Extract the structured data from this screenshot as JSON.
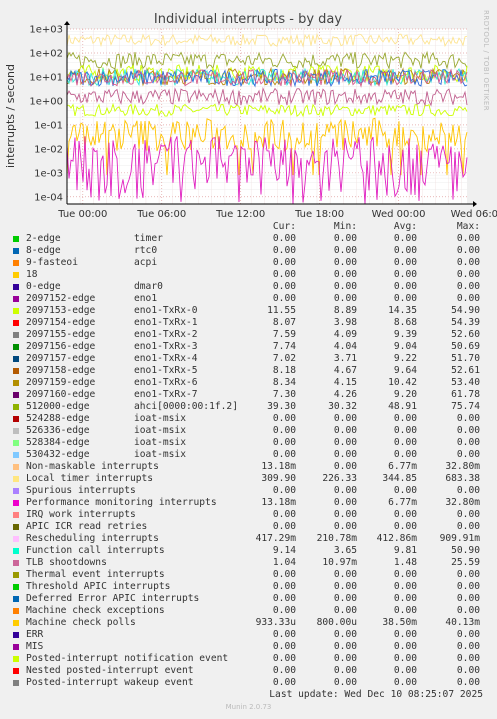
{
  "chart_data": {
    "type": "line",
    "title": "Individual interrupts - by day",
    "ylabel": "interrupts / second",
    "y_scale": "log",
    "ylim": [
      5e-05,
      1000
    ],
    "y_ticks": [
      "1e+03",
      "1e+02",
      "1e+01",
      "1e+00",
      "1e-01",
      "1e-02",
      "1e-03",
      "1e-04"
    ],
    "x_ticks": [
      "Tue 00:00",
      "Tue 06:00",
      "Tue 12:00",
      "Tue 18:00",
      "Wed 00:00",
      "Wed 06:00"
    ],
    "grid": true,
    "side_text": "RRDTOOL / TOBI OETIKER",
    "series": [
      {
        "name": "Local timer interrupts",
        "color": "#fde491",
        "approx": 345
      },
      {
        "name": "Rescheduling interrupts",
        "color": "#ccff00",
        "approx": 0.41
      },
      {
        "name": "512000-edge ahci[0000:00:1f.2]",
        "color": "#99a832",
        "approx": 48.9
      },
      {
        "name": "2097153-edge eno1-TxRx-0",
        "color": "#ccff00",
        "approx": 14.3
      },
      {
        "name": "2097159-edge eno1-TxRx-6",
        "color": "#b8860b",
        "approx": 10.4
      },
      {
        "name": "Function call interrupts",
        "color": "#2ee8d5",
        "approx": 9.8
      },
      {
        "name": "2097157-edge eno1-TxRx-4",
        "color": "#2e6bda",
        "approx": 9.2
      },
      {
        "name": "2097160-edge eno1-TxRx-7",
        "color": "#d75b8a",
        "approx": 9.2
      },
      {
        "name": "TLB shootdowns",
        "color": "#c0608f",
        "approx": 1.48
      },
      {
        "name": "Machine check polls",
        "color": "#ffc400",
        "approx": 0.0385
      },
      {
        "name": "Non-maskable interrupts",
        "color": "#e020c0",
        "approx": 0.0068
      }
    ]
  },
  "legend": {
    "headers": {
      "cur": "Cur:",
      "min": "Min:",
      "avg": "Avg:",
      "max": "Max:"
    },
    "rows": [
      {
        "name": "2-edge",
        "sub": "timer",
        "color": "#00cc00",
        "cur": "0.00",
        "min": "0.00",
        "avg": "0.00",
        "max": "0.00"
      },
      {
        "name": "8-edge",
        "sub": "rtc0",
        "color": "#0066b3",
        "cur": "0.00",
        "min": "0.00",
        "avg": "0.00",
        "max": "0.00"
      },
      {
        "name": "9-fasteoi",
        "sub": "acpi",
        "color": "#ff8000",
        "cur": "0.00",
        "min": "0.00",
        "avg": "0.00",
        "max": "0.00"
      },
      {
        "name": "18",
        "sub": "",
        "color": "#ffcc00",
        "cur": "0.00",
        "min": "0.00",
        "avg": "0.00",
        "max": "0.00"
      },
      {
        "name": "0-edge",
        "sub": "dmar0",
        "color": "#330099",
        "cur": "0.00",
        "min": "0.00",
        "avg": "0.00",
        "max": "0.00"
      },
      {
        "name": "2097152-edge",
        "sub": "eno1",
        "color": "#990099",
        "cur": "0.00",
        "min": "0.00",
        "avg": "0.00",
        "max": "0.00"
      },
      {
        "name": "2097153-edge",
        "sub": "eno1-TxRx-0",
        "color": "#ccff00",
        "cur": "11.55",
        "min": "8.89",
        "avg": "14.35",
        "max": "54.90"
      },
      {
        "name": "2097154-edge",
        "sub": "eno1-TxRx-1",
        "color": "#ff0000",
        "cur": "8.07",
        "min": "3.98",
        "avg": "8.68",
        "max": "54.39"
      },
      {
        "name": "2097155-edge",
        "sub": "eno1-TxRx-2",
        "color": "#808080",
        "cur": "7.59",
        "min": "4.09",
        "avg": "9.39",
        "max": "52.60"
      },
      {
        "name": "2097156-edge",
        "sub": "eno1-TxRx-3",
        "color": "#008f00",
        "cur": "7.74",
        "min": "4.04",
        "avg": "9.04",
        "max": "50.69"
      },
      {
        "name": "2097157-edge",
        "sub": "eno1-TxRx-4",
        "color": "#00487d",
        "cur": "7.02",
        "min": "3.71",
        "avg": "9.22",
        "max": "51.70"
      },
      {
        "name": "2097158-edge",
        "sub": "eno1-TxRx-5",
        "color": "#b35a00",
        "cur": "8.18",
        "min": "4.67",
        "avg": "9.64",
        "max": "52.61"
      },
      {
        "name": "2097159-edge",
        "sub": "eno1-TxRx-6",
        "color": "#b38f00",
        "cur": "8.34",
        "min": "4.15",
        "avg": "10.42",
        "max": "53.40"
      },
      {
        "name": "2097160-edge",
        "sub": "eno1-TxRx-7",
        "color": "#6b006b",
        "cur": "7.30",
        "min": "4.26",
        "avg": "9.20",
        "max": "61.78"
      },
      {
        "name": "512000-edge",
        "sub": "ahci[0000:00:1f.2]",
        "color": "#8fb300",
        "cur": "39.30",
        "min": "30.32",
        "avg": "48.91",
        "max": "75.74"
      },
      {
        "name": "524288-edge",
        "sub": "ioat-msix",
        "color": "#b30000",
        "cur": "0.00",
        "min": "0.00",
        "avg": "0.00",
        "max": "0.00"
      },
      {
        "name": "526336-edge",
        "sub": "ioat-msix",
        "color": "#bebebe",
        "cur": "0.00",
        "min": "0.00",
        "avg": "0.00",
        "max": "0.00"
      },
      {
        "name": "528384-edge",
        "sub": "ioat-msix",
        "color": "#80ff80",
        "cur": "0.00",
        "min": "0.00",
        "avg": "0.00",
        "max": "0.00"
      },
      {
        "name": "530432-edge",
        "sub": "ioat-msix",
        "color": "#80c9ff",
        "cur": "0.00",
        "min": "0.00",
        "avg": "0.00",
        "max": "0.00"
      },
      {
        "name": "Non-maskable interrupts",
        "sub": "",
        "color": "#ffc080",
        "cur": "13.18m",
        "min": "0.00",
        "avg": "6.77m",
        "max": "32.80m"
      },
      {
        "name": "Local timer interrupts",
        "sub": "",
        "color": "#ffe680",
        "cur": "309.90",
        "min": "226.33",
        "avg": "344.85",
        "max": "683.38"
      },
      {
        "name": "Spurious interrupts",
        "sub": "",
        "color": "#aa80ff",
        "cur": "0.00",
        "min": "0.00",
        "avg": "0.00",
        "max": "0.00"
      },
      {
        "name": "Performance monitoring interrupts",
        "sub": "",
        "color": "#ee00cc",
        "cur": "13.18m",
        "min": "0.00",
        "avg": "6.77m",
        "max": "32.80m"
      },
      {
        "name": "IRQ work interrupts",
        "sub": "",
        "color": "#ff8080",
        "cur": "0.00",
        "min": "0.00",
        "avg": "0.00",
        "max": "0.00"
      },
      {
        "name": "APIC ICR read retries",
        "sub": "",
        "color": "#666600",
        "cur": "0.00",
        "min": "0.00",
        "avg": "0.00",
        "max": "0.00"
      },
      {
        "name": "Rescheduling interrupts",
        "sub": "",
        "color": "#ffbfff",
        "cur": "417.29m",
        "min": "210.78m",
        "avg": "412.86m",
        "max": "909.91m"
      },
      {
        "name": "Function call interrupts",
        "sub": "",
        "color": "#00ffcc",
        "cur": "9.14",
        "min": "3.65",
        "avg": "9.81",
        "max": "50.90"
      },
      {
        "name": "TLB shootdowns",
        "sub": "",
        "color": "#cc6699",
        "cur": "1.04",
        "min": "10.97m",
        "avg": "1.48",
        "max": "25.59"
      },
      {
        "name": "Thermal event interrupts",
        "sub": "",
        "color": "#999900",
        "cur": "0.00",
        "min": "0.00",
        "avg": "0.00",
        "max": "0.00"
      },
      {
        "name": "Threshold APIC interrupts",
        "sub": "",
        "color": "#00cc00",
        "cur": "0.00",
        "min": "0.00",
        "avg": "0.00",
        "max": "0.00"
      },
      {
        "name": "Deferred Error APIC interrupts",
        "sub": "",
        "color": "#0066b3",
        "cur": "0.00",
        "min": "0.00",
        "avg": "0.00",
        "max": "0.00"
      },
      {
        "name": "Machine check exceptions",
        "sub": "",
        "color": "#ff8000",
        "cur": "0.00",
        "min": "0.00",
        "avg": "0.00",
        "max": "0.00"
      },
      {
        "name": "Machine check polls",
        "sub": "",
        "color": "#ffcc00",
        "cur": "933.33u",
        "min": "800.00u",
        "avg": "38.50m",
        "max": "40.13m"
      },
      {
        "name": "ERR",
        "sub": "",
        "color": "#330099",
        "cur": "0.00",
        "min": "0.00",
        "avg": "0.00",
        "max": "0.00"
      },
      {
        "name": "MIS",
        "sub": "",
        "color": "#990099",
        "cur": "0.00",
        "min": "0.00",
        "avg": "0.00",
        "max": "0.00"
      },
      {
        "name": "Posted-interrupt notification event",
        "sub": "",
        "color": "#ccff00",
        "cur": "0.00",
        "min": "0.00",
        "avg": "0.00",
        "max": "0.00"
      },
      {
        "name": "Nested posted-interrupt event",
        "sub": "",
        "color": "#ff0000",
        "cur": "0.00",
        "min": "0.00",
        "avg": "0.00",
        "max": "0.00"
      },
      {
        "name": "Posted-interrupt wakeup event",
        "sub": "",
        "color": "#808080",
        "cur": "0.00",
        "min": "0.00",
        "avg": "0.00",
        "max": "0.00"
      }
    ]
  },
  "footer": {
    "last_update": "Last update: Wed Dec 10 08:25:07 2025",
    "version": "Munin 2.0.73"
  }
}
